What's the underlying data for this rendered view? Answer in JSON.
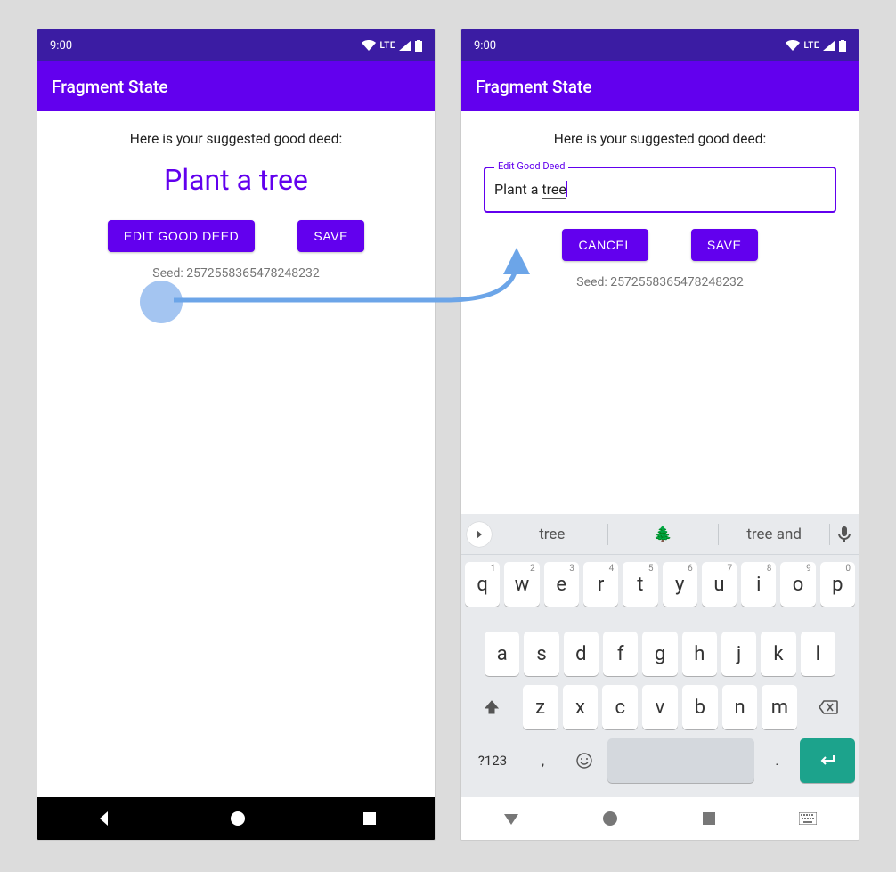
{
  "statusbar": {
    "time": "9:00",
    "lte": "LTE"
  },
  "toolbar": {
    "title": "Fragment State"
  },
  "hint_text": "Here is your suggested good deed:",
  "deed_text": "Plant a tree",
  "buttons": {
    "edit": "EDIT GOOD DEED",
    "save": "SAVE",
    "cancel": "CANCEL"
  },
  "seed_text": "Seed: 2572558365478248232",
  "edit_field": {
    "label": "Edit Good Deed",
    "value_prefix": "Plant a ",
    "value_underlined": "tree"
  },
  "keyboard": {
    "suggestions": [
      "tree",
      "🌲",
      "tree and"
    ],
    "row1": [
      "q",
      "w",
      "e",
      "r",
      "t",
      "y",
      "u",
      "i",
      "o",
      "p"
    ],
    "row1_nums": [
      "1",
      "2",
      "3",
      "4",
      "5",
      "6",
      "7",
      "8",
      "9",
      "0"
    ],
    "row2": [
      "a",
      "s",
      "d",
      "f",
      "g",
      "h",
      "j",
      "k",
      "l"
    ],
    "row3": [
      "z",
      "x",
      "c",
      "v",
      "b",
      "n",
      "m"
    ],
    "symbols_key": "?123",
    "comma": ",",
    "period": "."
  }
}
